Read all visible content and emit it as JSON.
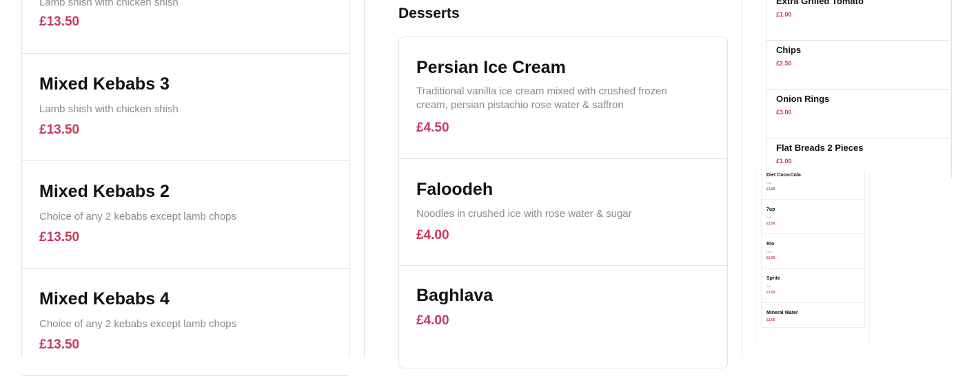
{
  "colors": {
    "price": "#c8385a",
    "description": "#8a8a8a",
    "border": "#e2e2e2"
  },
  "left_column": {
    "partial_item": {
      "description": "Lamb shish with chicken shish",
      "price": "£13.50"
    },
    "items": [
      {
        "name": "Mixed Kebabs 3",
        "description": "Lamb shish with chicken shish",
        "price": "£13.50"
      },
      {
        "name": "Mixed Kebabs 2",
        "description": "Choice of any 2 kebabs except lamb chops",
        "price": "£13.50"
      },
      {
        "name": "Mixed Kebabs 4",
        "description": "Choice of any 2 kebabs except lamb chops",
        "price": "£13.50"
      }
    ]
  },
  "desserts": {
    "title": "Desserts",
    "items": [
      {
        "name": "Persian Ice Cream",
        "description": "Traditional vanilla ice cream mixed with crushed frozen cream, persian pistachio rose water & saffron",
        "price": "£4.50"
      },
      {
        "name": "Faloodeh",
        "description": "Noodles in crushed ice with rose water & sugar",
        "price": "£4.00"
      },
      {
        "name": "Baghlava",
        "price": "£4.00"
      }
    ]
  },
  "extras": [
    {
      "name": "Extra Grilled Tomato",
      "price": "£1.00"
    },
    {
      "name": "Chips",
      "price": "£2.50"
    },
    {
      "name": "Onion Rings",
      "price": "£3.00"
    },
    {
      "name": "Flat Breads 2 Pieces",
      "price": "£1.00"
    }
  ],
  "drinks": [
    {
      "name": "Diet Coca-Cola",
      "sub": "Can",
      "price": "£1.50"
    },
    {
      "name": "7up",
      "sub": "Can",
      "price": "£1.50"
    },
    {
      "name": "Rio",
      "sub": "Can",
      "price": "£1.50"
    },
    {
      "name": "Sprite",
      "sub": "Can",
      "price": "£1.50"
    },
    {
      "name": "Mineral Water",
      "price": "£1.00"
    }
  ]
}
